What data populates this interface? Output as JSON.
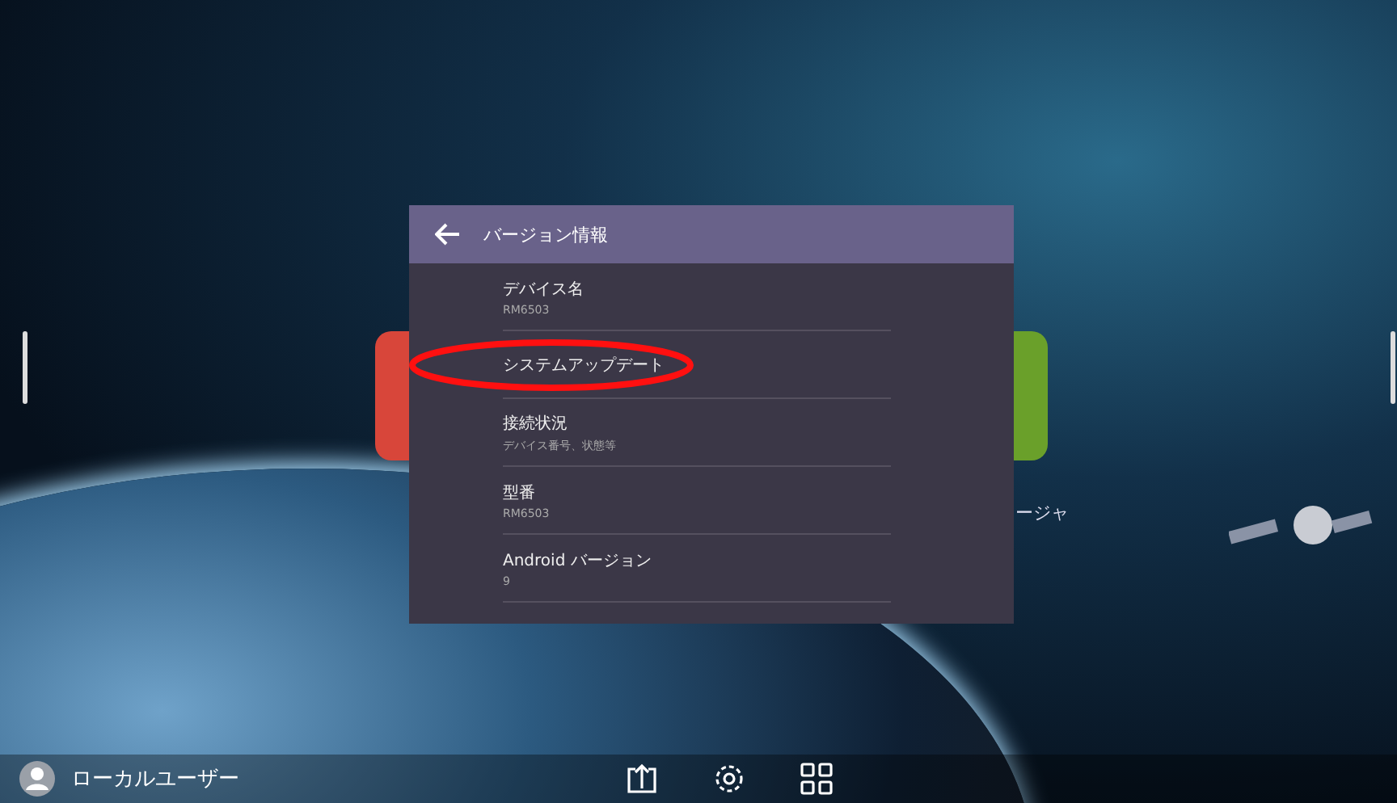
{
  "background_label": "ージャ",
  "dialog": {
    "title": "バージョン情報",
    "items": [
      {
        "title": "デバイス名",
        "subtitle": "RM6503",
        "circled": false
      },
      {
        "title": "システムアップデート",
        "circled": true
      },
      {
        "title": "接続状況",
        "subtitle": "デバイス番号、状態等",
        "circled": false
      },
      {
        "title": "型番",
        "subtitle": "RM6503",
        "circled": false
      },
      {
        "title": "Android バージョン",
        "subtitle": "9",
        "circled": false
      }
    ]
  },
  "taskbar": {
    "user": "ローカルユーザー"
  }
}
